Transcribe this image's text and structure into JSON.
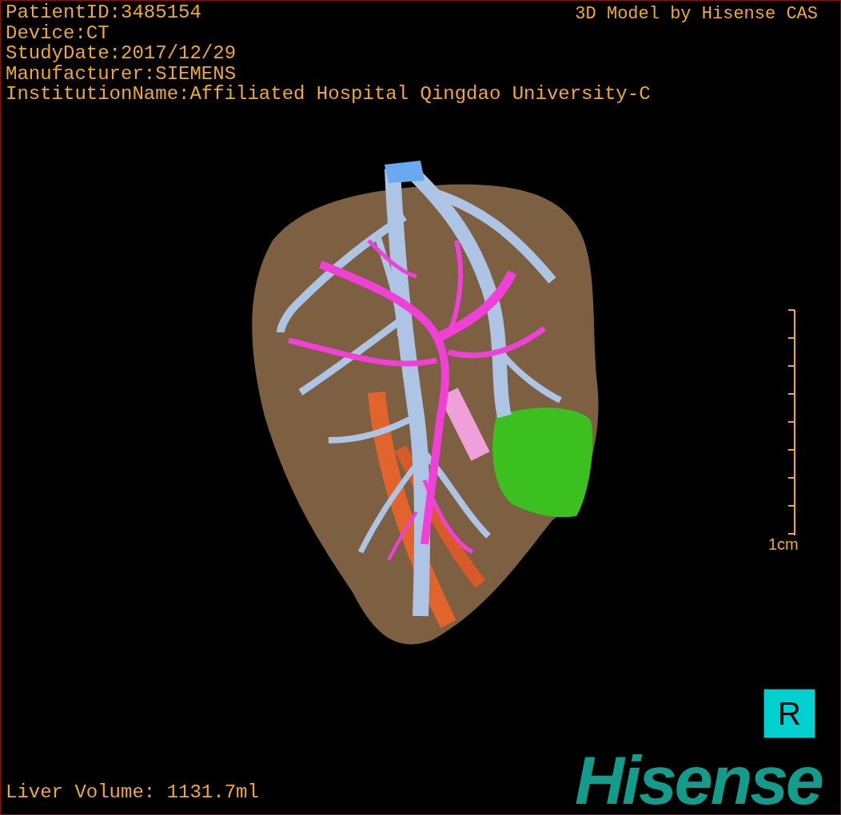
{
  "info_lines": [
    "PatientID:3485154",
    "Device:CT",
    "StudyDate:2017/12/29",
    "Manufacturer:SIEMENS",
    "InstitutionName:Affiliated Hospital Qingdao University-C"
  ],
  "credit": "3D Model by Hisense CAS",
  "scale_bar": {
    "label": "1cm"
  },
  "orientation_marker": "R",
  "liver_volume": "Liver Volume: 1131.7ml",
  "logo": "Hisense"
}
